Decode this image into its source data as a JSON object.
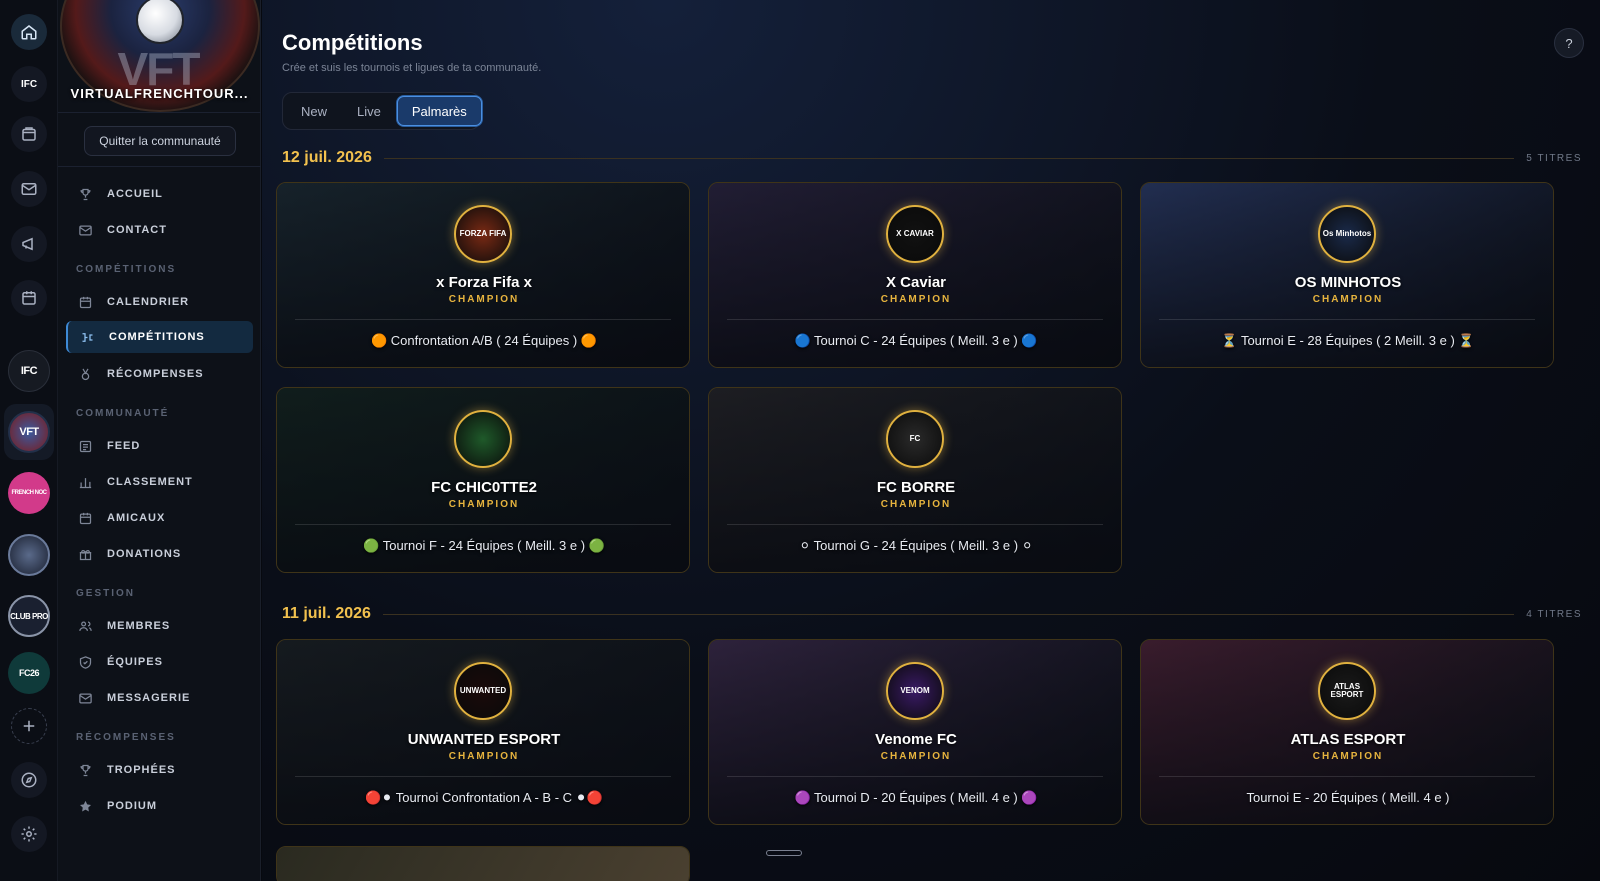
{
  "rail": {
    "icons": [
      {
        "name": "home-icon",
        "active": true
      },
      {
        "name": "ifc-logo",
        "label": "IFC"
      },
      {
        "name": "wallet-icon"
      },
      {
        "name": "mail-icon"
      },
      {
        "name": "megaphone-icon"
      },
      {
        "name": "calendar-icon"
      }
    ],
    "communities": [
      {
        "name": "IFC",
        "color": "#1b1f2a"
      },
      {
        "name": "VFT",
        "color": "#2a3c6b"
      },
      {
        "name": "FRENCH NOC",
        "color": "#d23a8a"
      },
      {
        "name": "",
        "color": "#3a4a66"
      },
      {
        "name": "CLUB PRO",
        "color": "#1a2030"
      },
      {
        "name": "FC26",
        "color": "#0f3a3a"
      }
    ]
  },
  "community": {
    "name": "VIRTUALFRENCHTOUR...",
    "banner_text": "VFT",
    "quit_label": "Quitter la communauté"
  },
  "nav": {
    "top": [
      {
        "label": "ACCUEIL",
        "icon": "trophy-icon"
      },
      {
        "label": "CONTACT",
        "icon": "mail-icon"
      }
    ],
    "sections": [
      {
        "title": "COMPÉTITIONS",
        "items": [
          {
            "label": "CALENDRIER",
            "icon": "calendar-icon"
          },
          {
            "label": "COMPÉTITIONS",
            "icon": "bracket-icon",
            "active": true
          },
          {
            "label": "RÉCOMPENSES",
            "icon": "medal-icon"
          }
        ]
      },
      {
        "title": "COMMUNAUTÉ",
        "items": [
          {
            "label": "FEED",
            "icon": "feed-icon"
          },
          {
            "label": "CLASSEMENT",
            "icon": "bar-chart-icon"
          },
          {
            "label": "AMICAUX",
            "icon": "calendar-icon"
          },
          {
            "label": "DONATIONS",
            "icon": "gift-icon"
          }
        ]
      },
      {
        "title": "GESTION",
        "items": [
          {
            "label": "MEMBRES",
            "icon": "users-icon"
          },
          {
            "label": "ÉQUIPES",
            "icon": "shield-icon"
          },
          {
            "label": "MESSAGERIE",
            "icon": "mail-icon"
          }
        ]
      },
      {
        "title": "RÉCOMPENSES",
        "items": [
          {
            "label": "TROPHÉES",
            "icon": "trophy-icon"
          },
          {
            "label": "PODIUM",
            "icon": "star-icon"
          }
        ]
      }
    ]
  },
  "page": {
    "title": "Compétitions",
    "subtitle": "Crée et suis les tournois et ligues de ta communauté.",
    "help": "?",
    "tabs": [
      {
        "label": "New"
      },
      {
        "label": "Live"
      },
      {
        "label": "Palmarès",
        "active": true
      }
    ]
  },
  "groups": [
    {
      "date": "12 juil. 2026",
      "count": "5 TITRES",
      "cards": [
        {
          "team": "x Forza Fifa x",
          "role": "CHAMPION",
          "desc": "🟠 Confrontation A/B ( 24 Équipes ) 🟠",
          "logo_text": "FORZA FIFA",
          "logo_color": "#7a2a14",
          "bg": "#1b2a33"
        },
        {
          "team": "X Caviar",
          "role": "CHAMPION",
          "desc": "🔵 Tournoi C - 24 Équipes ( Meill. 3 e ) 🔵",
          "logo_text": "X CAVIAR",
          "logo_color": "#111111",
          "bg": "#2a2440"
        },
        {
          "team": "OS MINHOTOS",
          "role": "CHAMPION",
          "desc": "⏳ Tournoi E - 28 Équipes ( 2 Meill. 3 e ) ⏳",
          "logo_text": "Os Minhotos",
          "logo_color": "#1a2a4a",
          "bg": "#2a3a66"
        },
        {
          "team": "FC CHIC0TTE2",
          "role": "CHAMPION",
          "desc": "🟢 Tournoi F - 24 Équipes ( Meill. 3 e ) 🟢",
          "logo_text": "",
          "logo_color": "#1f5a2a",
          "bg": "#132420"
        },
        {
          "team": "FC BORRE",
          "role": "CHAMPION",
          "desc": "⚪ Tournoi G - 24 Équipes ( Meill. 3 e ) ⚪",
          "logo_text": "FC",
          "logo_color": "#2a2a2a",
          "bg": "#242428"
        }
      ]
    },
    {
      "date": "11 juil. 2026",
      "count": "4 TITRES",
      "cards": [
        {
          "team": "UNWANTED ESPORT",
          "role": "CHAMPION",
          "desc": "🔴⚫ Tournoi Confrontation A - B - C ⚫🔴",
          "logo_text": "UNWANTED",
          "logo_color": "#1a0a0a",
          "bg": "#1a2024"
        },
        {
          "team": "Venome FC",
          "role": "CHAMPION",
          "desc": "🟣 Tournoi D - 20 Équipes ( Meill. 4 e ) 🟣",
          "logo_text": "VENOM",
          "logo_color": "#3a1a66",
          "bg": "#3a2a4a"
        },
        {
          "team": "ATLAS ESPORT",
          "role": "CHAMPION",
          "desc": "Tournoi E - 20 Équipes ( Meill. 4 e )",
          "logo_text": "ATLAS ESPORT",
          "logo_color": "#1a1a1a",
          "bg": "#4a2236"
        }
      ]
    }
  ],
  "colors": {
    "accent_gold": "#e7b43e",
    "date_gold": "#f2c14e",
    "active_tab": "#1a3a6a",
    "active_nav": "#132a40"
  }
}
